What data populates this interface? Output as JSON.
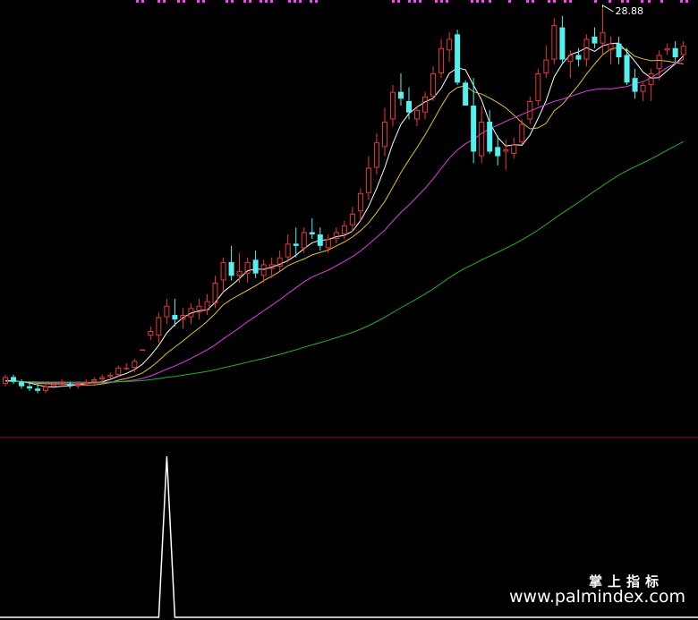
{
  "chart_data": [
    {
      "type": "candlestick",
      "panel": "price",
      "high_label": "28.88",
      "colors": {
        "up": "#e8383a",
        "down": "#54f0f0",
        "ma5": "#ffffff",
        "ma10": "#e0c030",
        "ma20": "#e23ce2",
        "ma60": "#20b030"
      },
      "candles": [
        [
          12.5,
          12.9,
          12.4,
          12.8
        ],
        [
          12.8,
          12.9,
          12.5,
          12.6
        ],
        [
          12.6,
          12.7,
          12.3,
          12.4
        ],
        [
          12.4,
          12.6,
          12.2,
          12.3
        ],
        [
          12.3,
          12.5,
          12.1,
          12.2
        ],
        [
          12.2,
          12.5,
          12.1,
          12.4
        ],
        [
          12.4,
          12.6,
          12.3,
          12.5
        ],
        [
          12.5,
          12.7,
          12.4,
          12.6
        ],
        [
          12.5,
          12.6,
          12.3,
          12.4
        ],
        [
          12.4,
          12.6,
          12.3,
          12.5
        ],
        [
          12.5,
          12.7,
          12.4,
          12.6
        ],
        [
          12.6,
          12.8,
          12.5,
          12.7
        ],
        [
          12.7,
          12.9,
          12.6,
          12.8
        ],
        [
          12.8,
          13.0,
          12.7,
          12.9
        ],
        [
          12.9,
          13.3,
          12.8,
          13.2
        ],
        [
          13.2,
          13.4,
          13.1,
          13.2
        ],
        [
          13.2,
          13.6,
          13.0,
          13.5
        ],
        [
          14.0,
          14.0,
          14.0,
          14.0
        ],
        [
          14.6,
          15.0,
          14.4,
          14.8
        ],
        [
          14.6,
          15.6,
          14.3,
          15.4
        ],
        [
          15.4,
          16.2,
          15.1,
          15.9
        ],
        [
          15.5,
          16.2,
          15.0,
          15.3
        ],
        [
          15.3,
          15.8,
          14.9,
          15.5
        ],
        [
          15.4,
          16.0,
          15.1,
          15.8
        ],
        [
          15.6,
          16.2,
          15.3,
          15.9
        ],
        [
          15.7,
          16.4,
          15.5,
          16.1
        ],
        [
          16.0,
          17.2,
          15.8,
          16.9
        ],
        [
          17.0,
          18.0,
          16.5,
          17.8
        ],
        [
          17.8,
          18.5,
          17.0,
          17.2
        ],
        [
          17.2,
          18.2,
          16.9,
          17.4
        ],
        [
          17.3,
          18.0,
          16.9,
          17.8
        ],
        [
          17.9,
          18.3,
          17.1,
          17.3
        ],
        [
          17.2,
          17.9,
          16.9,
          17.7
        ],
        [
          17.5,
          18.0,
          17.1,
          17.7
        ],
        [
          17.6,
          18.3,
          17.4,
          18.0
        ],
        [
          18.0,
          19.0,
          17.8,
          18.6
        ],
        [
          18.6,
          19.3,
          18.0,
          18.5
        ],
        [
          18.4,
          19.3,
          18.2,
          19.1
        ],
        [
          19.1,
          19.7,
          18.8,
          19.0
        ],
        [
          19.0,
          19.3,
          18.3,
          18.5
        ],
        [
          18.4,
          19.0,
          18.2,
          18.8
        ],
        [
          18.8,
          19.3,
          18.6,
          19.1
        ],
        [
          19.0,
          19.6,
          18.8,
          19.4
        ],
        [
          19.4,
          20.2,
          19.1,
          19.9
        ],
        [
          20.0,
          21.0,
          19.6,
          20.8
        ],
        [
          20.8,
          22.4,
          20.5,
          21.9
        ],
        [
          21.9,
          23.4,
          21.6,
          23.0
        ],
        [
          22.8,
          24.5,
          22.4,
          23.9
        ],
        [
          24.0,
          25.5,
          23.7,
          25.2
        ],
        [
          25.2,
          26.0,
          24.6,
          24.9
        ],
        [
          24.8,
          25.4,
          24.0,
          24.3
        ],
        [
          24.0,
          24.6,
          23.7,
          24.4
        ],
        [
          24.3,
          25.2,
          24.0,
          25.0
        ],
        [
          25.0,
          26.3,
          24.8,
          26.0
        ],
        [
          26.0,
          27.5,
          25.8,
          27.1
        ],
        [
          27.0,
          27.8,
          26.5,
          27.5
        ],
        [
          27.7,
          27.9,
          25.5,
          25.6
        ],
        [
          25.6,
          25.7,
          24.6,
          24.6
        ],
        [
          24.6,
          25.8,
          22.1,
          22.6
        ],
        [
          22.4,
          24.6,
          22.1,
          23.9
        ],
        [
          23.9,
          24.4,
          22.5,
          22.6
        ],
        [
          22.8,
          23.3,
          22.0,
          22.4
        ],
        [
          22.6,
          23.1,
          21.8,
          22.7
        ],
        [
          22.5,
          23.2,
          22.3,
          22.9
        ],
        [
          23.0,
          24.0,
          22.9,
          23.8
        ],
        [
          24.0,
          25.0,
          23.8,
          24.8
        ],
        [
          24.8,
          26.2,
          24.6,
          26.0
        ],
        [
          26.0,
          27.2,
          25.8,
          26.6
        ],
        [
          26.6,
          28.4,
          26.4,
          28.1
        ],
        [
          28.0,
          28.5,
          26.4,
          26.6
        ],
        [
          26.5,
          27.0,
          25.8,
          26.8
        ],
        [
          26.8,
          27.1,
          26.3,
          26.6
        ],
        [
          26.6,
          27.7,
          26.3,
          27.5
        ],
        [
          27.6,
          28.0,
          27.1,
          27.3
        ],
        [
          27.3,
          28.88,
          26.8,
          27.8
        ],
        [
          27.0,
          27.6,
          26.4,
          27.3
        ],
        [
          27.3,
          27.6,
          26.4,
          26.7
        ],
        [
          26.8,
          27.1,
          25.5,
          25.6
        ],
        [
          25.8,
          26.2,
          24.9,
          25.2
        ],
        [
          25.2,
          25.6,
          24.8,
          25.5
        ],
        [
          25.5,
          26.2,
          24.8,
          26.0
        ],
        [
          26.2,
          27.0,
          25.7,
          26.8
        ],
        [
          27.0,
          27.3,
          26.8,
          27.1
        ],
        [
          27.1,
          27.4,
          26.5,
          26.7
        ],
        [
          26.8,
          27.4,
          26.6,
          27.2
        ]
      ]
    },
    {
      "type": "line",
      "panel": "indicator",
      "color": "#ffffff",
      "values": [
        0,
        0,
        0,
        0,
        0,
        0,
        0,
        0,
        0,
        0,
        0,
        0,
        0,
        0,
        0,
        0,
        0,
        0,
        0,
        0,
        1,
        0,
        0,
        0,
        0,
        0,
        0,
        0,
        0,
        0,
        0,
        0,
        0,
        0,
        0,
        0,
        0,
        0,
        0,
        0,
        0,
        0,
        0,
        0,
        0,
        0,
        0,
        0,
        0,
        0,
        0,
        0,
        0,
        0,
        0,
        0,
        0,
        0,
        0,
        0,
        0,
        0,
        0,
        0,
        0,
        0,
        0,
        0,
        0,
        0,
        0,
        0,
        0,
        0,
        0,
        0,
        0,
        0,
        0,
        0,
        0,
        0,
        0,
        0,
        0
      ]
    }
  ],
  "watermark": {
    "chinese": "掌上指标",
    "url": "www.palmindex.com"
  }
}
